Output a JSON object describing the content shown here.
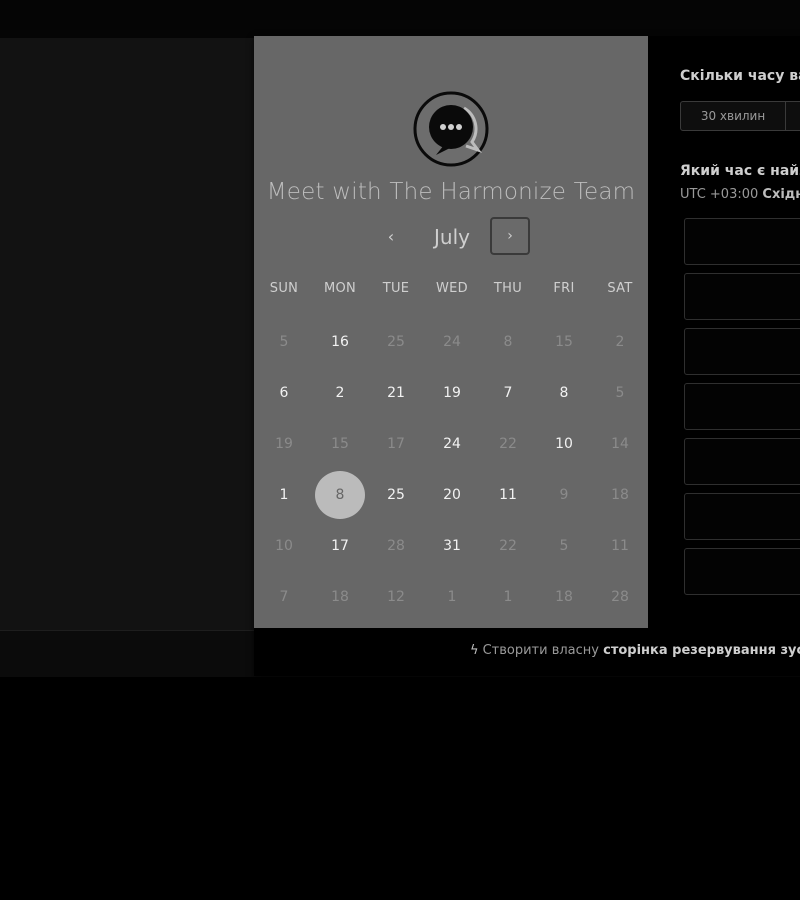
{
  "calendar": {
    "title": "Meet with The Harmonize Team",
    "month": "July",
    "prev_icon": "‹",
    "next_icon": "›",
    "weekdays": [
      "SUN",
      "MON",
      "TUE",
      "WED",
      "THU",
      "FRI",
      "SAT"
    ],
    "weeks": [
      [
        {
          "d": "5",
          "a": false
        },
        {
          "d": "16",
          "a": true
        },
        {
          "d": "25",
          "a": false
        },
        {
          "d": "24",
          "a": false
        },
        {
          "d": "8",
          "a": false
        },
        {
          "d": "15",
          "a": false
        },
        {
          "d": "2",
          "a": false
        }
      ],
      [
        {
          "d": "6",
          "a": true
        },
        {
          "d": "2",
          "a": true
        },
        {
          "d": "21",
          "a": true
        },
        {
          "d": "19",
          "a": true
        },
        {
          "d": "7",
          "a": true
        },
        {
          "d": "8",
          "a": true
        },
        {
          "d": "5",
          "a": false
        }
      ],
      [
        {
          "d": "19",
          "a": false
        },
        {
          "d": "15",
          "a": false
        },
        {
          "d": "17",
          "a": false
        },
        {
          "d": "24",
          "a": true
        },
        {
          "d": "22",
          "a": false
        },
        {
          "d": "10",
          "a": true
        },
        {
          "d": "14",
          "a": false
        }
      ],
      [
        {
          "d": "1",
          "a": true
        },
        {
          "d": "8",
          "a": true,
          "sel": true
        },
        {
          "d": "25",
          "a": true
        },
        {
          "d": "20",
          "a": true
        },
        {
          "d": "11",
          "a": true
        },
        {
          "d": "9",
          "a": false
        },
        {
          "d": "18",
          "a": false
        }
      ],
      [
        {
          "d": "10",
          "a": false
        },
        {
          "d": "17",
          "a": true
        },
        {
          "d": "28",
          "a": false
        },
        {
          "d": "31",
          "a": true
        },
        {
          "d": "22",
          "a": false
        },
        {
          "d": "5",
          "a": false
        },
        {
          "d": "11",
          "a": false
        }
      ],
      [
        {
          "d": "7",
          "a": false
        },
        {
          "d": "18",
          "a": false
        },
        {
          "d": "12",
          "a": false
        },
        {
          "d": "1",
          "a": false
        },
        {
          "d": "1",
          "a": false
        },
        {
          "d": "18",
          "a": false
        },
        {
          "d": "28",
          "a": false
        }
      ]
    ]
  },
  "booking": {
    "duration_question": "Скільки часу ва",
    "durations": [
      "30 хвилин",
      ""
    ],
    "time_question": "Який час є найл",
    "timezone_prefix": "UTC +03:00 ",
    "timezone_name": "Східн",
    "slot_count": 7
  },
  "footer": {
    "icon": "hubspot-sprocket-icon",
    "icon_glyph": "ϟ",
    "text_plain": "Створити власну ",
    "text_bold": "сторінка резервування зустрі"
  },
  "colors": {
    "calendar_bg": "#676767",
    "selected_day": "#bbbbbb",
    "page_bg": "#000000"
  }
}
